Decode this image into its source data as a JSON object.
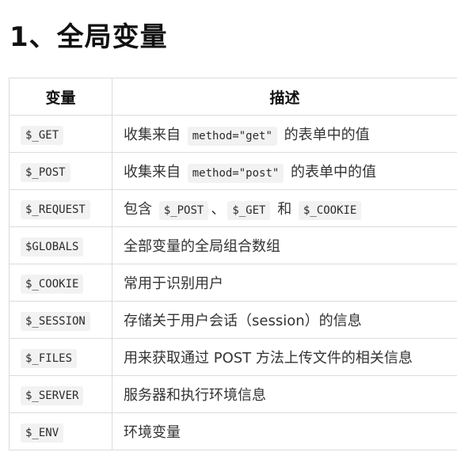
{
  "heading": "1、全局变量",
  "table": {
    "headers": {
      "variable": "变量",
      "description": "描述"
    },
    "rows": [
      {
        "name": "$_GET",
        "parts": [
          {
            "text": "收集来自 "
          },
          {
            "code": "method=\"get\""
          },
          {
            "text": " 的表单中的值"
          }
        ]
      },
      {
        "name": "$_POST",
        "parts": [
          {
            "text": "收集来自 "
          },
          {
            "code": "method=\"post\""
          },
          {
            "text": " 的表单中的值"
          }
        ]
      },
      {
        "name": "$_REQUEST",
        "parts": [
          {
            "text": "包含 "
          },
          {
            "code": "$_POST"
          },
          {
            "text": "、"
          },
          {
            "code": "$_GET"
          },
          {
            "text": " 和 "
          },
          {
            "code": "$_COOKIE"
          }
        ]
      },
      {
        "name": "$GLOBALS",
        "parts": [
          {
            "text": "全部变量的全局组合数组"
          }
        ]
      },
      {
        "name": "$_COOKIE",
        "parts": [
          {
            "text": "常用于识别用户"
          }
        ]
      },
      {
        "name": "$_SESSION",
        "parts": [
          {
            "text": "存储关于用户会话（session）的信息"
          }
        ]
      },
      {
        "name": "$_FILES",
        "parts": [
          {
            "text": "用来获取通过 POST 方法上传文件的相关信息"
          }
        ]
      },
      {
        "name": "$_SERVER",
        "parts": [
          {
            "text": "服务器和执行环境信息"
          }
        ]
      },
      {
        "name": "$_ENV",
        "parts": [
          {
            "text": "环境变量"
          }
        ]
      }
    ]
  }
}
